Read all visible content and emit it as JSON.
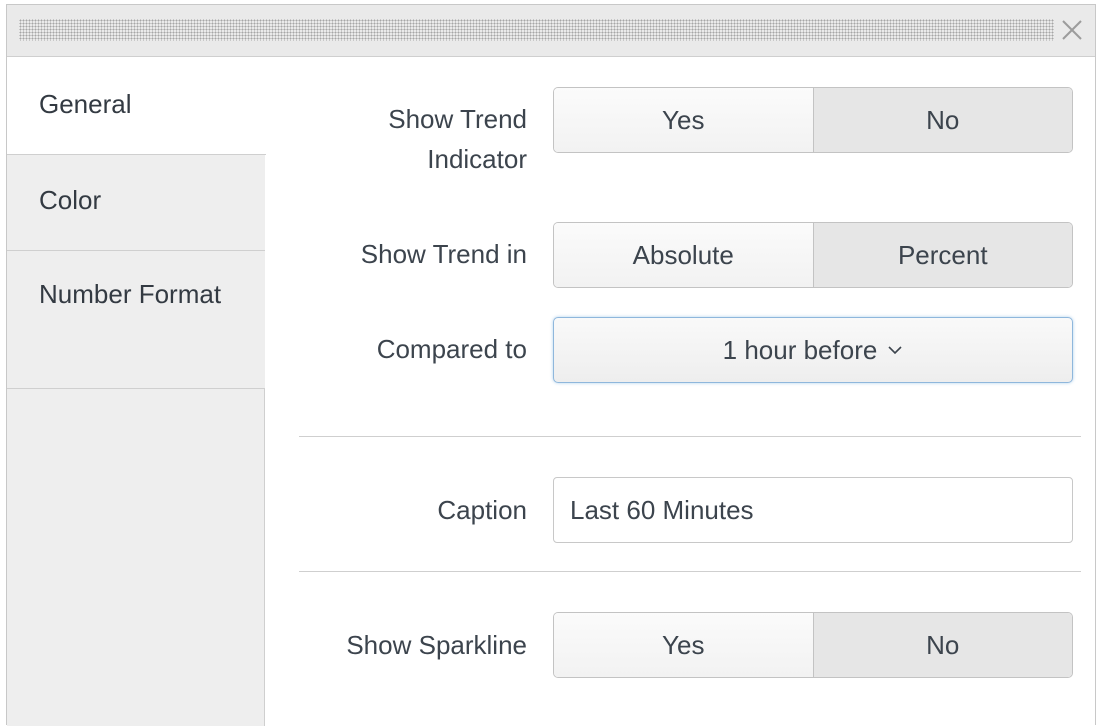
{
  "dialog": {
    "close_icon": "close-x-icon"
  },
  "sidebar": {
    "items": [
      {
        "label": "General",
        "active": true
      },
      {
        "label": "Color",
        "active": false
      },
      {
        "label": "Number Format",
        "active": false
      }
    ]
  },
  "form": {
    "trend_indicator": {
      "label": "Show Trend Indicator",
      "options": [
        "Yes",
        "No"
      ],
      "selected": "Yes"
    },
    "trend_in": {
      "label": "Show Trend in",
      "options": [
        "Absolute",
        "Percent"
      ],
      "selected": "Absolute"
    },
    "compared_to": {
      "label": "Compared to",
      "value": "1 hour before",
      "icon": "chevron-down-icon"
    },
    "caption": {
      "label": "Caption",
      "value": "Last 60 Minutes"
    },
    "sparkline": {
      "label": "Show Sparkline",
      "options": [
        "Yes",
        "No"
      ],
      "selected": "Yes"
    }
  },
  "colors": {
    "focus_border": "#8fb7dc",
    "selected_segment": "#f7f7f7",
    "unselected_segment": "#e6e6e6",
    "sidebar_bg": "#eeeeee"
  }
}
